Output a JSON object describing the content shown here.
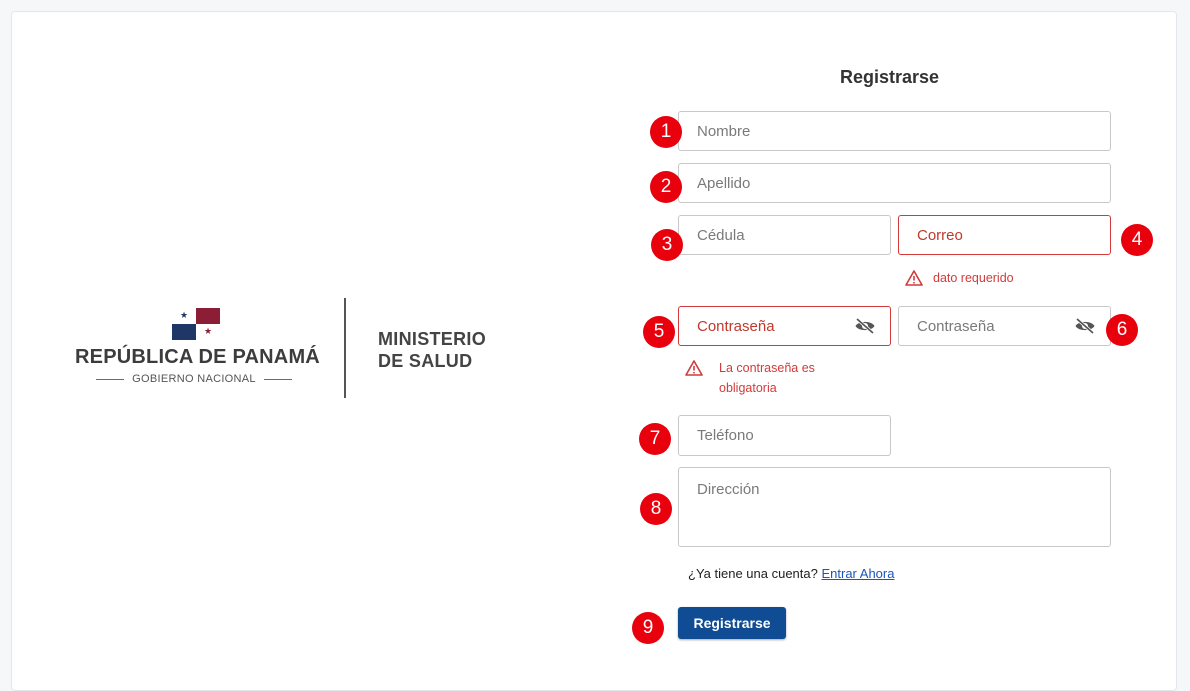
{
  "logo": {
    "republica": "REPÚBLICA DE PANAMÁ",
    "gobierno": "GOBIERNO NACIONAL",
    "ministerio_line1": "MINISTERIO",
    "ministerio_line2": "DE SALUD",
    "flag_colors": {
      "red": "#8b1d35",
      "blue": "#1f3766",
      "white": "#ffffff"
    }
  },
  "form": {
    "title": "Registrarse",
    "fields": {
      "nombre": {
        "placeholder": "Nombre",
        "badge": "1"
      },
      "apellido": {
        "placeholder": "Apellido",
        "badge": "2"
      },
      "cedula": {
        "placeholder": "Cédula",
        "badge": "3"
      },
      "correo": {
        "placeholder": "Correo",
        "badge": "4",
        "error": "dato requerido"
      },
      "password": {
        "placeholder": "Contraseña",
        "badge": "5",
        "error_line1": "La contraseña es",
        "error_line2": "obligatoria"
      },
      "password_confirm": {
        "placeholder": "Contraseña",
        "badge": "6"
      },
      "telefono": {
        "placeholder": "Teléfono",
        "badge": "7"
      },
      "direccion": {
        "placeholder": "Dirección",
        "badge": "8"
      }
    },
    "account_question": "¿Ya tiene una cuenta?",
    "account_link": "Entrar Ahora",
    "submit_label": "Registrarse",
    "submit_badge": "9"
  },
  "colors": {
    "error": "#d23a3a",
    "badge": "#e8000d",
    "primary": "#0f4c93",
    "link": "#1a56b8"
  },
  "icons": {
    "password_toggle": "eye-off-icon",
    "warning": "warning-triangle-icon"
  }
}
